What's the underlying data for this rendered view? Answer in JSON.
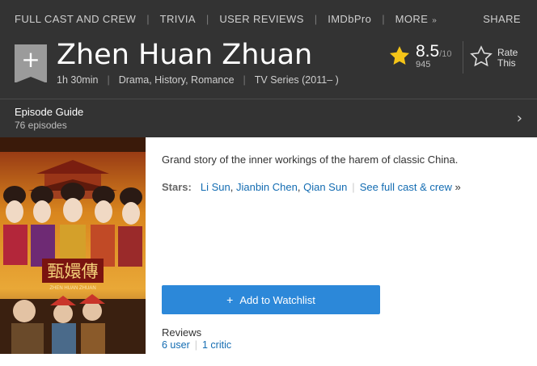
{
  "nav": {
    "items": [
      "FULL CAST AND CREW",
      "TRIVIA",
      "USER REVIEWS",
      "IMDbPro",
      "MORE"
    ],
    "share": "SHARE"
  },
  "header": {
    "title": "Zhen Huan Zhuan",
    "runtime": "1h 30min",
    "genres": "Drama, History, Romance",
    "type": "TV Series (2011– )",
    "watchlist_plus": "+"
  },
  "rating": {
    "score": "8.5",
    "out_of": "/10",
    "votes": "945",
    "rate_line1": "Rate",
    "rate_line2": "This"
  },
  "episodes": {
    "title": "Episode Guide",
    "count": "76 episodes"
  },
  "poster": {
    "title_text": "甄嬛傳",
    "sub_text": "ZHEN HUAN ZHUAN"
  },
  "main": {
    "plot": "Grand story of the inner workings of the harem of classic China.",
    "stars_label": "Stars:",
    "stars": [
      "Li Sun",
      "Jianbin Chen",
      "Qian Sun"
    ],
    "full_cast": "See full cast & crew",
    "full_cast_arrow": "»",
    "watchlist_button": "Add to Watchlist",
    "watchlist_plus": "+",
    "reviews_heading": "Reviews",
    "user_reviews": "6 user",
    "critic_reviews": "1 critic"
  },
  "colors": {
    "header_bg": "#333333",
    "star": "#f5c518",
    "link": "#136cb2",
    "button": "#2c88d9"
  }
}
